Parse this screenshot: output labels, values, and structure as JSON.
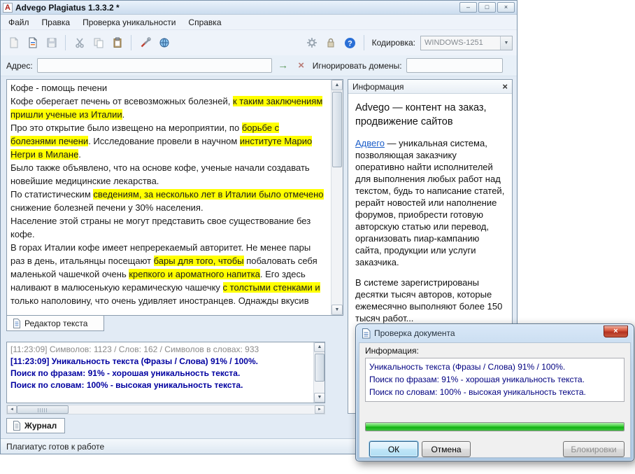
{
  "window": {
    "title": "Advego Plagiatus 1.3.3.2 *",
    "app_icon_letter": "A",
    "menu": [
      "Файл",
      "Правка",
      "Проверка уникальности",
      "Справка"
    ],
    "controls": {
      "minimize": "–",
      "maximize": "□",
      "close": "×"
    },
    "encoding": {
      "label": "Кодировка:",
      "value": "WINDOWS-1251"
    },
    "address": {
      "label": "Адрес:",
      "value": ""
    },
    "ignore_domains": {
      "label": "Игнорировать домены:",
      "value": ""
    },
    "editor_tab": "Редактор текста",
    "journal_tab": "Журнал",
    "status": "Плагиатус готов к работе"
  },
  "icons": {
    "go_arrow": "→",
    "clear_x": "×",
    "dropdown": "▼",
    "panel_close": "×",
    "scroll_up": "▲",
    "scroll_down": "▼",
    "scroll_left": "◄",
    "scroll_right": "►"
  },
  "document": {
    "paragraphs": [
      [
        {
          "t": "Кофе - помощь печени",
          "h": false
        }
      ],
      [
        {
          "t": "Кофе оберегает печень от всевозможных болезней, ",
          "h": false
        },
        {
          "t": "к таким заключениям пришли ученые из Италии",
          "h": true
        },
        {
          "t": ".",
          "h": false
        }
      ],
      [
        {
          "t": "Про это открытие было извещено на мероприятии, по ",
          "h": false
        },
        {
          "t": "борьбе с болезнями печени",
          "h": true
        },
        {
          "t": ". Исследование провели в научном ",
          "h": false
        },
        {
          "t": "институте Марио Негри в Милане",
          "h": true
        },
        {
          "t": ".",
          "h": false
        }
      ],
      [
        {
          "t": "Было также объявлено, что на основе кофе, ученые начали создавать новейшие медицинские лекарства.",
          "h": false
        }
      ],
      [
        {
          "t": "По статистическим ",
          "h": false
        },
        {
          "t": "сведениям, за несколько лет в Италии было отмечено",
          "h": true
        },
        {
          "t": " снижение болезней печени у 30% населения.",
          "h": false
        }
      ],
      [
        {
          "t": "Население этой страны не могут представить свое существование без кофе.",
          "h": false
        }
      ],
      [
        {
          "t": "В горах Италии кофе имеет непререкаемый авторитет. Не менее пары раз в день, итальянцы посещают ",
          "h": false
        },
        {
          "t": "бары для того, чтобы",
          "h": true
        },
        {
          "t": " побаловать себя маленькой чашечкой очень ",
          "h": false
        },
        {
          "t": "крепкого и ароматного напитка",
          "h": true
        },
        {
          "t": ". Его здесь наливают в малюсенькую керамическую чашечку ",
          "h": false
        },
        {
          "t": "с толстыми стенками и",
          "h": true
        },
        {
          "t": " только наполовину, что очень удивляет иностранцев. Однажды вкусив",
          "h": false
        }
      ]
    ]
  },
  "info_panel": {
    "title": "Информация",
    "heading": "Advego — контент на заказ, продвижение сайтов",
    "para1": [
      {
        "t": "Адвего",
        "link": true
      },
      {
        "t": " — уникальная система, позволяющая заказчику оперативно найти исполнителей для выполнения любых работ над текстом, будь то написание статей, рерайт новостей или наполнение форумов, приобрести готовую авторскую статью или перевод, организовать пиар-кампанию сайта, продукции или услуги заказчика.",
        "link": false
      }
    ],
    "para2": "В системе зарегистрированы десятки тысяч авторов, которые ежемесячно выполняют более 150 тысяч работ..."
  },
  "log": {
    "lines": [
      {
        "text": "[11:23:09] Символов: 1123 / Слов: 162 / Символов в словах: 933",
        "style": "stats"
      },
      {
        "text": "[11:23:09] Уникальность текста (Фразы / Слова) 91% / 100%.",
        "style": "result"
      },
      {
        "text": "Поиск по фразам: 91% - хорошая уникальность текста.",
        "style": "result"
      },
      {
        "text": "Поиск по словам: 100% - высокая уникальность текста.",
        "style": "result"
      }
    ]
  },
  "dialog": {
    "title": "Проверка документа",
    "info_label": "Информация:",
    "lines": [
      "Уникальность текста (Фразы / Слова) 91% / 100%.",
      "Поиск по фразам: 91% - хорошая уникальность текста.",
      "Поиск по словам: 100% - высокая уникальность текста."
    ],
    "progress_percent": 100,
    "buttons": {
      "ok": "ОК",
      "cancel": "Отмена",
      "block": "Блокировки"
    }
  }
}
